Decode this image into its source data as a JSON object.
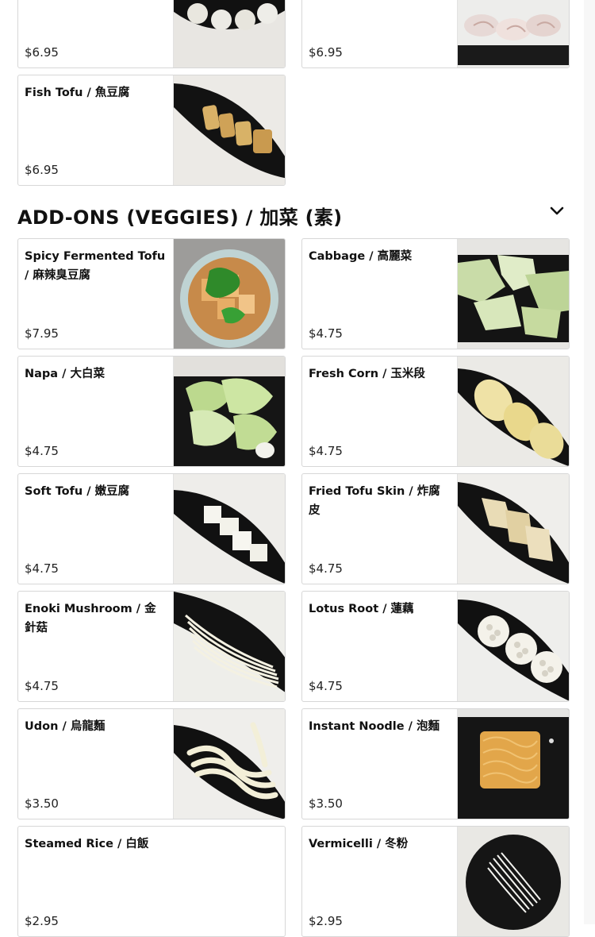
{
  "menu": {
    "prev_items": [
      {
        "name": "",
        "price": "$6.95"
      },
      {
        "name": "",
        "price": "$6.95"
      },
      {
        "name": "Fish Tofu / 魚豆腐",
        "price": "$6.95"
      }
    ],
    "section": {
      "title": "ADD-ONS (VEGGIES) / 加菜 (素)",
      "toggle_icon": "chevron-down-icon"
    },
    "items": [
      {
        "name": "Spicy Fermented Tofu / 麻辣臭豆腐",
        "price": "$7.95",
        "image": "fermented-tofu-photo"
      },
      {
        "name": "Cabbage / 高麗菜",
        "price": "$4.75",
        "image": "cabbage-photo"
      },
      {
        "name": "Napa / 大白菜",
        "price": "$4.75",
        "image": "napa-photo"
      },
      {
        "name": "Fresh Corn / 玉米段",
        "price": "$4.75",
        "image": "corn-photo"
      },
      {
        "name": "Soft Tofu / 嫩豆腐",
        "price": "$4.75",
        "image": "soft-tofu-photo"
      },
      {
        "name": "Fried Tofu Skin / 炸腐皮",
        "price": "$4.75",
        "image": "tofu-skin-photo"
      },
      {
        "name": "Enoki Mushroom / 金針菇",
        "price": "$4.75",
        "image": "enoki-photo"
      },
      {
        "name": "Lotus Root / 蓮藕",
        "price": "$4.75",
        "image": "lotus-root-photo"
      },
      {
        "name": "Udon / 烏龍麵",
        "price": "$3.50",
        "image": "udon-photo"
      },
      {
        "name": "Instant Noodle / 泡麵",
        "price": "$3.50",
        "image": "instant-noodle-photo"
      },
      {
        "name": "Steamed Rice / 白飯",
        "price": "$2.95"
      },
      {
        "name": "Vermicelli / 冬粉",
        "price": "$2.95",
        "image": "vermicelli-photo"
      }
    ]
  }
}
